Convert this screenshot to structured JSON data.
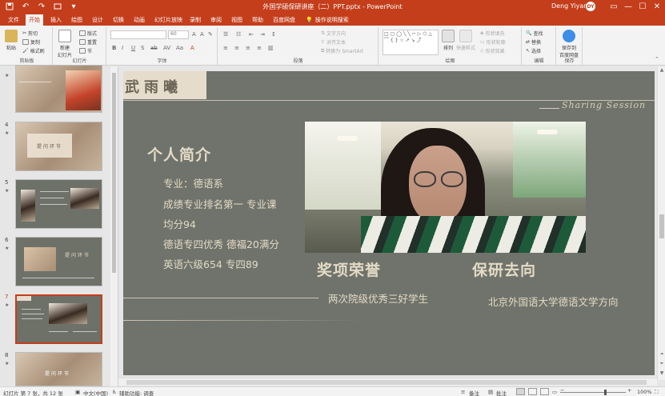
{
  "window": {
    "title": "外国学硕保研讲座（二）PPT.pptx - PowerPoint",
    "user": "Deng Yiyang",
    "user_initials": "DY",
    "quick_access": [
      "save-icon",
      "undo-icon",
      "redo-icon",
      "start-slideshow-icon"
    ],
    "controls": [
      "ribbon-display-icon",
      "minimize-icon",
      "maximize-icon",
      "close-icon"
    ]
  },
  "menu_tabs": [
    "文件",
    "开始",
    "插入",
    "绘图",
    "设计",
    "切换",
    "动画",
    "幻灯片放映",
    "录制",
    "审阅",
    "视图",
    "帮助",
    "百度网盘"
  ],
  "active_tab": "开始",
  "tell_me": "操作说明搜索",
  "ribbon": {
    "clipboard": {
      "label": "剪贴板",
      "paste": "粘贴",
      "cut": "剪切",
      "copy": "复制",
      "format_painter": "格式刷"
    },
    "slides": {
      "label": "幻灯片",
      "new_slide": "新建\n幻灯片",
      "layout": "版式",
      "reset": "重置",
      "section": "节"
    },
    "font": {
      "label": "字体",
      "font_size": "60"
    },
    "paragraph": {
      "label": "段落",
      "text_direction": "文字方向",
      "align_text": "对齐文本",
      "smartart": "转换为 SmartArt"
    },
    "drawing": {
      "label": "绘图",
      "arrange": "排列",
      "quick_styles": "快速样式",
      "shape_fill": "形状填充",
      "shape_outline": "形状轮廓",
      "shape_effects": "形状效果"
    },
    "editing": {
      "label": "编辑",
      "find": "查找",
      "replace": "替换",
      "select": "选择"
    },
    "save": {
      "label": "保存",
      "save_baidu": "保存到\n百度网盘"
    }
  },
  "thumbnails": [
    {
      "num": "",
      "star": "★"
    },
    {
      "num": "4",
      "star": "★",
      "title": "提问环节"
    },
    {
      "num": "5",
      "star": "★"
    },
    {
      "num": "6",
      "star": "★",
      "title": "提问环节"
    },
    {
      "num": "7",
      "star": "★"
    },
    {
      "num": "8",
      "star": "★",
      "title": "提问环节"
    }
  ],
  "slide": {
    "name": "武雨曦",
    "tagline": "Sharing Session",
    "intro_heading": "个人简介",
    "bio_lines": [
      "专业：德语系",
      "成绩专业排名第一 专业课",
      "均分94",
      "德语专四优秀 德福20满分",
      "英语六级654 专四89"
    ],
    "award_heading": "奖项荣誉",
    "award_text": "两次院级优秀三好学生",
    "grad_heading": "保研去向",
    "grad_text": "北京外国语大学德语文学方向"
  },
  "status": {
    "slide_info": "幻灯片 第 7 张，共 12 张",
    "language": "中文(中国)",
    "accessibility": "辅助功能: 调查",
    "notes": "备注",
    "comments": "批注",
    "zoom": "100%"
  },
  "colors": {
    "accent": "#c43e1c",
    "slide_background": "#6f736b",
    "slide_text": "#e4dac6",
    "name_box": "#e6dccc"
  }
}
